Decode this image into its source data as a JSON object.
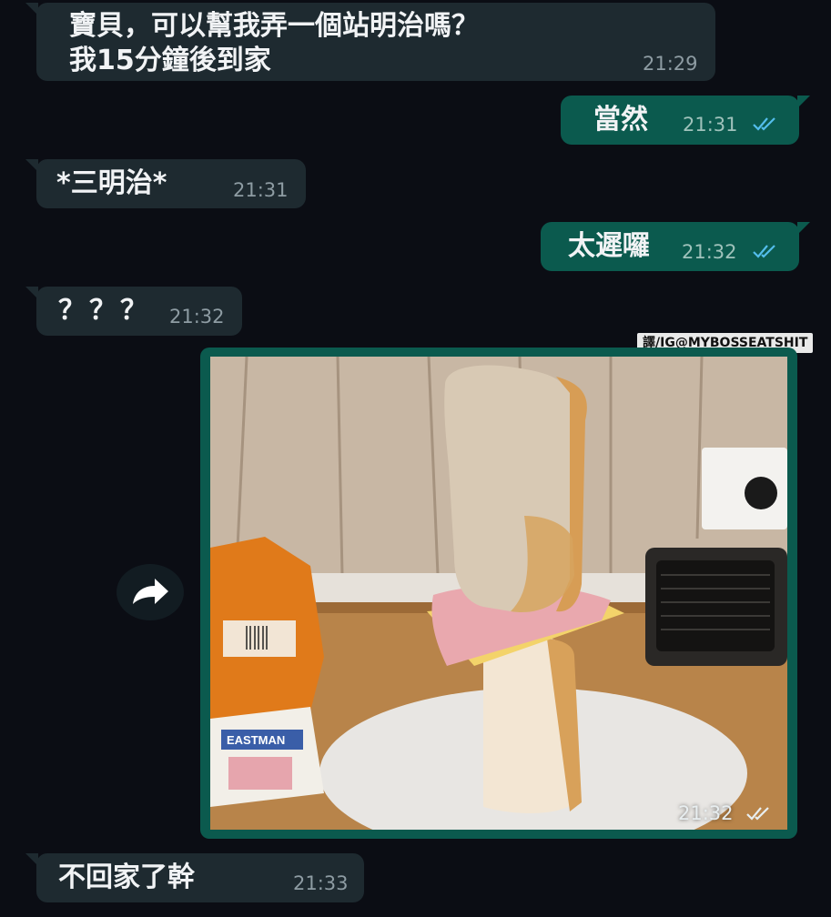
{
  "messages": [
    {
      "id": "m1",
      "side": "in",
      "text_line1": "寶貝，可以幫我弄一個站明治嗎？",
      "text_line2": "我15分鐘後到家",
      "time": "21:29"
    },
    {
      "id": "m2",
      "side": "out",
      "text": "當然",
      "time": "21:31",
      "read": true
    },
    {
      "id": "m3",
      "side": "in",
      "text": "*三明治*",
      "time": "21:31"
    },
    {
      "id": "m4",
      "side": "out",
      "text": "太遲囉",
      "time": "21:32",
      "read": true
    },
    {
      "id": "m5",
      "side": "in",
      "text": "？？？",
      "time": "21:32"
    },
    {
      "id": "m6",
      "side": "out",
      "type": "image",
      "time": "21:32",
      "read": true,
      "caption_watermark": "譯/IG@MYBOSSEATSHIT",
      "photo_description_icon": "standing-sandwich-photo",
      "package_label": "EASTMAN"
    },
    {
      "id": "m7",
      "side": "in",
      "text": "不回家了幹",
      "time": "21:33"
    }
  ],
  "icons": {
    "read_receipt": "double-check-icon",
    "forward": "forward-arrow-icon"
  },
  "colors": {
    "background": "#0b0d14",
    "incoming_bubble": "#1e2a30",
    "outgoing_bubble": "#0b5a4e",
    "read_tick": "#53bdeb"
  }
}
